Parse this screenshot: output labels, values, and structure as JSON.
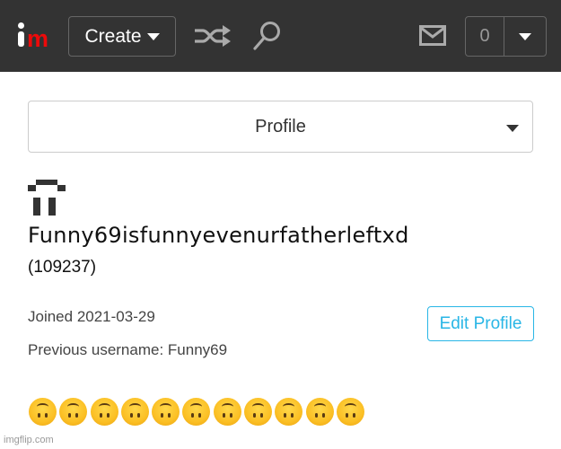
{
  "topbar": {
    "logo": {
      "i": "i",
      "m": "m"
    },
    "create_label": "Create",
    "icons": [
      "shuffle-icon",
      "search-icon",
      "mail-icon"
    ],
    "notification_count": "0"
  },
  "profile_select": {
    "selected": "Profile"
  },
  "user": {
    "avatar": "pixel-art-avatar",
    "username": "Funny69isfunnyevenurfatherleftxd",
    "id": "(109237)",
    "joined": "Joined 2021-03-29",
    "previous_username": "Previous username: Funny69",
    "edit_label": "Edit Profile",
    "bio_emojis": [
      "🙃",
      "🙃",
      "🙃",
      "🙃",
      "🙃",
      "🙃",
      "🙃",
      "🙃",
      "🙃",
      "🙃",
      "🙃"
    ]
  },
  "watermark": "imgflip.com",
  "colors": {
    "topbar": "#333333",
    "logo_m": "#ee0a0a",
    "accent": "#29b6e6"
  }
}
